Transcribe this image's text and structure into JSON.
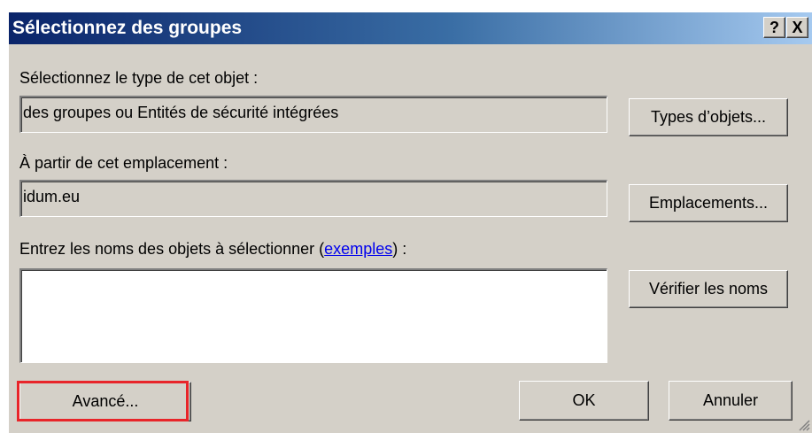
{
  "dialog": {
    "title": "Sélectionnez des groupes",
    "help_label": "?",
    "close_label": "X"
  },
  "object_type": {
    "label": "Sélectionnez le type de cet objet :",
    "value": "des groupes ou Entités de sécurité intégrées",
    "button_label": "Types d’objets..."
  },
  "location": {
    "label": "À partir de cet emplacement :",
    "value": "idum.eu",
    "button_label": "Emplacements..."
  },
  "names": {
    "label_prefix": "Entrez les noms des objets à sélectionner (",
    "link_label": "exemples",
    "label_suffix": ") :",
    "value": "",
    "check_button_label": "Vérifier les noms"
  },
  "footer": {
    "advanced_label": "Avancé...",
    "ok_label": "OK",
    "cancel_label": "Annuler"
  },
  "colors": {
    "title_start": "#0a246a",
    "title_end": "#a6caf0",
    "face": "#d4d0c8",
    "highlight": "#e8252a"
  }
}
